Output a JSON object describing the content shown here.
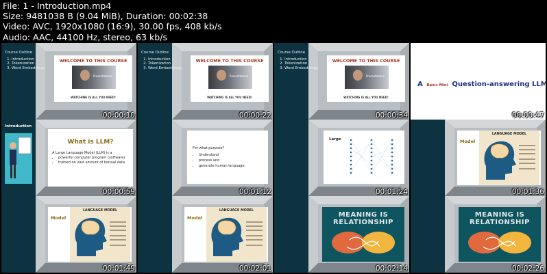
{
  "header": {
    "file_line": "File: 1 - Introduction.mp4",
    "size_line": "Size: 9481038 B (9.04 MiB), Duration: 00:02:38",
    "video_line": "Video: AVC, 1920x1080 (16:9), 30.00 fps, 408 kb/s",
    "audio_line": "Audio: AAC, 44100 Hz, stereo, 63 kb/s"
  },
  "outline": {
    "title": "Course Outline",
    "items": [
      "Introduction",
      "Tokenization",
      "Word Embeddings"
    ]
  },
  "welcome": {
    "title": "WELCOME TO THIS COURSE",
    "img_text": "Presentations",
    "footer": "WATCHING IS ALL YOU NEED!"
  },
  "qa_slide": {
    "a": "A",
    "small": "Basic Mini",
    "main": "Question-answering LLM"
  },
  "intro_label": "Introduction",
  "llm": {
    "title": "What is LLM?",
    "line": "A Large Language Model (LLM) is a",
    "bullets": [
      "powerful computer program (software)",
      "trained on vast amount of textual data"
    ]
  },
  "purpose": {
    "q": "For what purpose?",
    "bullets": [
      "Understand",
      "process and",
      "generate human language."
    ]
  },
  "large_label": "Large",
  "model_label": "Model",
  "lm_title": "LANGUAGE MODEL",
  "meaning_title": "MEANING IS RELATIONSHIP",
  "timestamps": [
    "00:00:10",
    "00:00:22",
    "00:00:34",
    "00:00:47",
    "00:00:59",
    "00:01:12",
    "00:01:24",
    "00:01:36",
    "00:01:49",
    "00:02:01",
    "00:02:14",
    "00:02:26"
  ],
  "colors": {
    "background": "#000000",
    "room": "#b9bec2",
    "teal": "#0e3340",
    "accent": "#a3341c"
  }
}
